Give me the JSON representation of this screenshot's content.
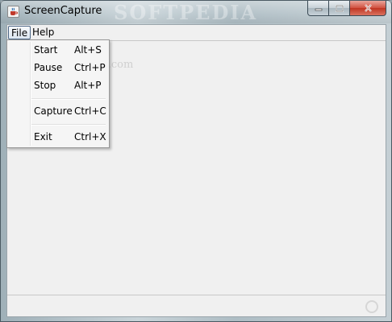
{
  "window": {
    "title": "ScreenCapture",
    "title_watermark": "SOFTPEDIA"
  },
  "menubar": {
    "items": [
      {
        "label": "File"
      },
      {
        "label": "Help"
      }
    ]
  },
  "file_menu": {
    "items": [
      {
        "label": "Start",
        "shortcut": "Alt+S"
      },
      {
        "label": "Pause",
        "shortcut": "Ctrl+P"
      },
      {
        "label": "Stop",
        "shortcut": "Alt+P"
      },
      {
        "label": "Capture",
        "shortcut": "Ctrl+C"
      },
      {
        "label": "Exit",
        "shortcut": "Ctrl+X"
      }
    ]
  },
  "content": {
    "watermark": "www.softpedia.com"
  },
  "icons": {
    "app": "java-cup-icon",
    "minimize": "minimize-icon",
    "maximize": "maximize-icon",
    "close": "close-icon",
    "status": "status-circle-icon"
  },
  "colors": {
    "close_button": "#c03522",
    "menu_highlight_border": "#4b6584",
    "client_background": "#f0f0f0"
  }
}
